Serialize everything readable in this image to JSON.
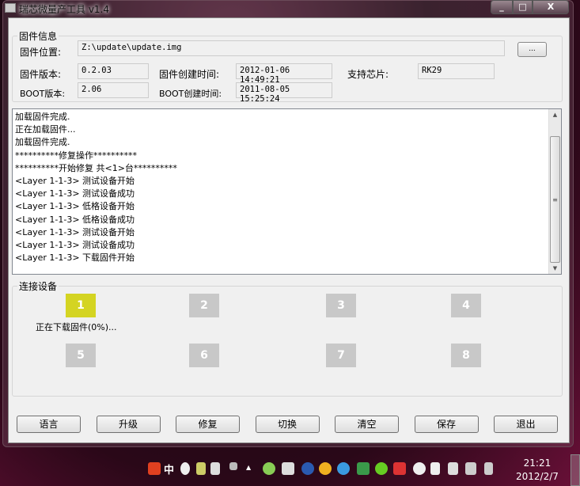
{
  "window": {
    "title": "瑞芯微量产工具 v1.4",
    "controls": [
      "_",
      "□",
      "X"
    ]
  },
  "firmware_info": {
    "legend": "固件信息",
    "location_label": "固件位置:",
    "location_value": "Z:\\update\\update.img",
    "browse_label": "...",
    "version_label": "固件版本:",
    "version_value": "0.2.03",
    "create_time_label": "固件创建时间:",
    "create_time_value": "2012-01-06 14:49:21",
    "chip_label": "支持芯片:",
    "chip_value": "RK29",
    "boot_version_label": "BOOT版本:",
    "boot_version_value": "2.06",
    "boot_time_label": "BOOT创建时间:",
    "boot_time_value": "2011-08-05 15:25:24"
  },
  "log": [
    "加载固件完成.",
    "正在加载固件...",
    "加载固件完成.",
    "**********修复操作**********",
    "**********开始修复 共<1>台**********",
    "<Layer 1-1-3> 测试设备开始",
    "<Layer 1-1-3> 测试设备成功",
    "<Layer 1-1-3> 低格设备开始",
    "<Layer 1-1-3> 低格设备成功",
    "<Layer 1-1-3> 测试设备开始",
    "<Layer 1-1-3> 测试设备成功",
    "<Layer 1-1-3> 下载固件开始"
  ],
  "devices": {
    "legend": "连接设备",
    "slots": [
      "1",
      "2",
      "3",
      "4",
      "5",
      "6",
      "7",
      "8"
    ],
    "active_slot": "1",
    "active_color": "#d4d422",
    "status": "正在下载固件(0%)..."
  },
  "buttons": [
    "语言",
    "升级",
    "修复",
    "切换",
    "清空",
    "保存",
    "退出"
  ],
  "taskbar": {
    "time": "21:21",
    "date": "2012/2/7",
    "ime": "中"
  }
}
